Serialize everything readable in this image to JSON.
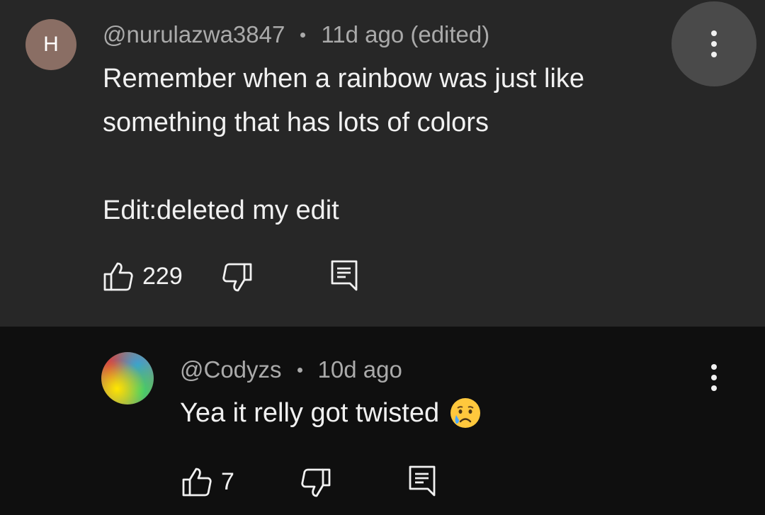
{
  "comments": [
    {
      "avatar_letter": "H",
      "avatar_color": "#8a6e64",
      "username": "@nurulazwa3847",
      "time": "11d ago (edited)",
      "text": "Remember when a rainbow was just like\nsomething that has lots of colors\n\nEdit:deleted my edit",
      "likes": "229",
      "background": "#272727"
    },
    {
      "username": "@Codyzs",
      "time": "10d ago",
      "text": "Yea it relly got twisted",
      "emoji": "crying-face-emoji",
      "likes": "7",
      "background": "#0f0f0f"
    }
  ],
  "icons": {
    "like": "thumbs-up-icon",
    "dislike": "thumbs-down-icon",
    "reply": "reply-comment-icon",
    "menu": "more-vertical-icon"
  }
}
